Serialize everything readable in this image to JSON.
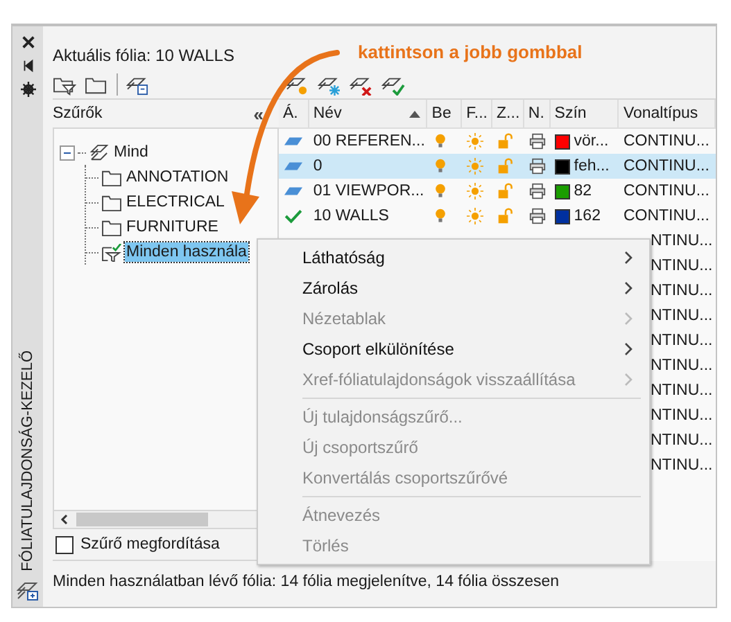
{
  "annotation": "kattintson a jobb gombbal",
  "palette": {
    "title": "FÓLIATULAJDONSÁG-KEZELŐ"
  },
  "current_layer": "Aktuális fólia: 10 WALLS",
  "filters": {
    "header": "Szűrők",
    "collapse": "«",
    "tree": [
      {
        "label": "Mind",
        "expanded": true,
        "selected": false,
        "kind": "all",
        "children": [
          {
            "label": "ANNOTATION",
            "selected": false,
            "kind": "group"
          },
          {
            "label": "ELECTRICAL",
            "selected": false,
            "kind": "group"
          },
          {
            "label": "FURNITURE",
            "selected": false,
            "kind": "group"
          },
          {
            "label": "Minden használa",
            "selected": true,
            "kind": "used"
          }
        ]
      }
    ],
    "invert": {
      "label": "Szűrő megfordítása",
      "checked": false
    }
  },
  "table": {
    "columns": [
      "Á.",
      "Név",
      "Be",
      "F...",
      "Z...",
      "N.",
      "Szín",
      "Vonaltípus"
    ],
    "rows": [
      {
        "kind": "full",
        "current": false,
        "selected": false,
        "name": "00 REFEREN...",
        "color": "#ff0000",
        "color_name": "vör...",
        "linetype": "CONTINU..."
      },
      {
        "kind": "full",
        "current": false,
        "selected": true,
        "name": "0",
        "color": "#000000",
        "color_name": "feh...",
        "linetype": "CONTINU..."
      },
      {
        "kind": "full",
        "current": false,
        "selected": false,
        "name": "01 VIEWPOR...",
        "color": "#1a9e00",
        "color_name": "82",
        "linetype": "CONTINU..."
      },
      {
        "kind": "full",
        "current": true,
        "selected": false,
        "name": "10 WALLS",
        "color": "#0030a0",
        "color_name": "162",
        "linetype": "CONTINU..."
      },
      {
        "kind": "partial",
        "linetype": "NTINU..."
      },
      {
        "kind": "partial",
        "linetype": "NTINU..."
      },
      {
        "kind": "partial",
        "linetype": "NTINU..."
      },
      {
        "kind": "partial",
        "linetype": "NTINU..."
      },
      {
        "kind": "partial",
        "linetype": "NTINU..."
      },
      {
        "kind": "partial",
        "linetype": "NTINU..."
      },
      {
        "kind": "partial",
        "linetype": "NTINU..."
      },
      {
        "kind": "partial",
        "linetype": "NTINU..."
      },
      {
        "kind": "partial",
        "linetype": "NTINU..."
      },
      {
        "kind": "partial",
        "linetype": "NTINU..."
      }
    ]
  },
  "context_menu": [
    {
      "kind": "item",
      "label": "Láthatóság",
      "submenu": true,
      "disabled": false
    },
    {
      "kind": "item",
      "label": "Zárolás",
      "submenu": true,
      "disabled": false
    },
    {
      "kind": "item",
      "label": "Nézetablak",
      "submenu": true,
      "disabled": true
    },
    {
      "kind": "item",
      "label": "Csoport elkülönítése",
      "submenu": true,
      "disabled": false
    },
    {
      "kind": "item",
      "label": "Xref-fóliatulajdonságok visszaállítása",
      "submenu": true,
      "disabled": true
    },
    {
      "kind": "separator"
    },
    {
      "kind": "item",
      "label": "Új tulajdonságszűrő...",
      "submenu": false,
      "disabled": true
    },
    {
      "kind": "item",
      "label": "Új csoportszűrő",
      "submenu": false,
      "disabled": true
    },
    {
      "kind": "item",
      "label": "Konvertálás csoportszűrővé",
      "submenu": false,
      "disabled": true
    },
    {
      "kind": "separator"
    },
    {
      "kind": "item",
      "label": "Átnevezés",
      "submenu": false,
      "disabled": true
    },
    {
      "kind": "item",
      "label": "Törlés",
      "submenu": false,
      "disabled": true
    }
  ],
  "status_bar": "Minden használatban lévő fólia: 14 fólia megjelenítve, 14 fólia összesen"
}
